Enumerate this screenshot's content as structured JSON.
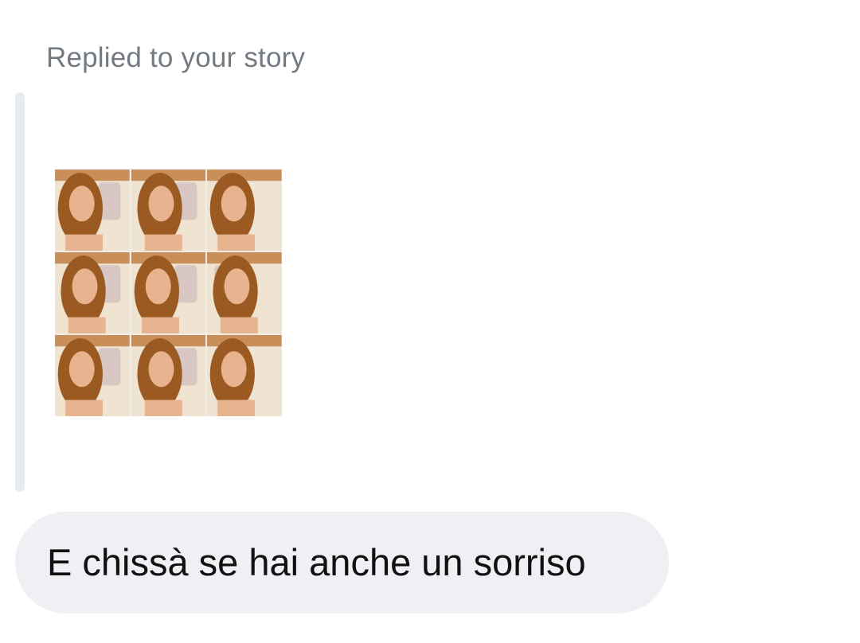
{
  "reply_context": {
    "label": "Replied to your story"
  },
  "story_thumbnail": {
    "tile_count": 9,
    "palette": {
      "ceiling": "#c98f5a",
      "wall": "#efe3d2",
      "hair": "#9b5a22",
      "skin": "#e7b48f",
      "phone": "#d8c7c2"
    }
  },
  "message": {
    "text": "E chissà se hai anche un sorriso"
  },
  "colors": {
    "label_text": "#737a82",
    "bubble_bg": "#eef0f3",
    "reply_bar": "#e8ebee",
    "message_text": "#111111"
  }
}
